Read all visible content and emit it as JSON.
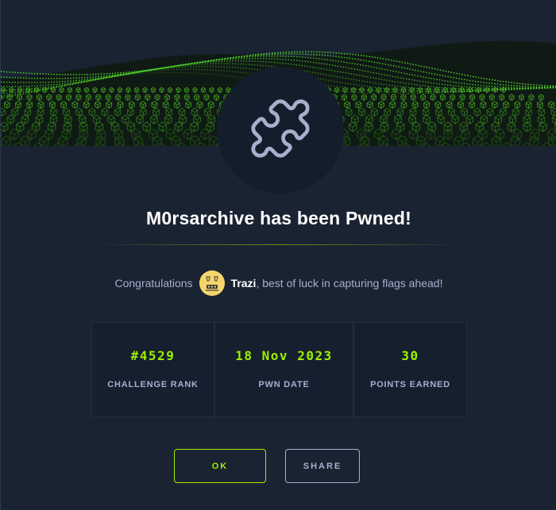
{
  "modal": {
    "title": "M0rsarchive has been Pwned!",
    "congrats_prefix": "Congratulations",
    "username": "Trazi",
    "congrats_suffix": ", best of luck in capturing flags ahead!",
    "stats": [
      {
        "value": "#4529",
        "label": "CHALLENGE RANK"
      },
      {
        "value": "18 Nov 2023",
        "label": "PWN DATE"
      },
      {
        "value": "30",
        "label": "POINTS EARNED"
      }
    ],
    "buttons": {
      "ok": "OK",
      "share": "SHARE"
    }
  },
  "icons": {
    "badge": "puzzle-icon",
    "avatar": "user-avatar"
  },
  "colors": {
    "accent": "#9fef00",
    "background": "#1a2332",
    "panel": "#151f2e",
    "text": "#a4b1cd",
    "title": "#ffffff"
  }
}
